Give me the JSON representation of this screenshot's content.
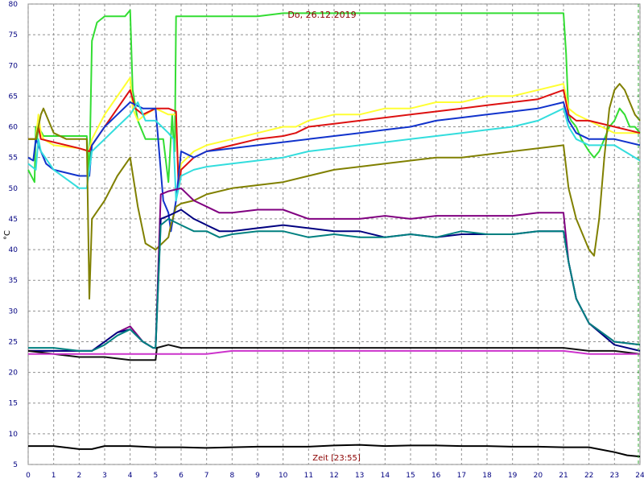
{
  "chart_data": {
    "type": "line",
    "title": "Do, 26.12.2019",
    "xlabel": "Zeit [23:55]",
    "ylabel": "°C",
    "xlim": [
      0,
      24
    ],
    "ylim": [
      5,
      80
    ],
    "x_ticks": [
      "0",
      "1",
      "2",
      "3",
      "4",
      "5",
      "6",
      "7",
      "8",
      "9",
      "10",
      "11",
      "12",
      "13",
      "14",
      "15",
      "16",
      "17",
      "18",
      "19",
      "20",
      "21",
      "22",
      "23",
      "24"
    ],
    "y_ticks": [
      "5",
      "10",
      "15",
      "20",
      "25",
      "30",
      "35",
      "40",
      "45",
      "50",
      "55",
      "60",
      "65",
      "70",
      "75",
      "80"
    ],
    "grid": true,
    "legend": "none",
    "series": [
      {
        "color": "#33dd33",
        "x": [
          0,
          0.25,
          0.3,
          0.35,
          0.4,
          0.6,
          0.8,
          1,
          2.3,
          2.4,
          2.5,
          2.7,
          3,
          3.8,
          4,
          4.1,
          4.3,
          4.6,
          5,
          5.3,
          5.5,
          5.65,
          5.7,
          5.75,
          5.8,
          6,
          7,
          8,
          9,
          10,
          12,
          14,
          16,
          18,
          20,
          21,
          21.1,
          21.2,
          21.3,
          21.5,
          21.7,
          22,
          22.2,
          22.4,
          22.6,
          22.8,
          23,
          23.2,
          23.4,
          23.6,
          23.8,
          24
        ],
        "y": [
          53,
          51,
          60,
          58,
          60,
          58.5,
          58.5,
          58.5,
          58.5,
          52,
          74,
          77,
          78,
          78,
          79,
          66,
          61,
          58,
          58,
          58,
          51,
          62,
          58,
          56,
          78,
          78,
          78,
          78,
          78,
          78.5,
          78.5,
          78.5,
          78.5,
          78.5,
          78.5,
          78.5,
          72,
          62,
          61,
          60,
          58,
          56,
          55,
          56,
          58,
          60,
          61,
          63,
          62,
          60,
          60,
          59
        ]
      },
      {
        "color": "#ffff33",
        "x": [
          0,
          0.3,
          0.4,
          0.5,
          0.6,
          0.8,
          1,
          2,
          2.4,
          2.5,
          3,
          3.5,
          4,
          4.1,
          4.3,
          4.6,
          5,
          5.5,
          5.8,
          5.9,
          6,
          6.5,
          7,
          8,
          9,
          10,
          10.5,
          11,
          12,
          13,
          14,
          15,
          16,
          17,
          18,
          19,
          20,
          21,
          21.2,
          21.5,
          22,
          23,
          23.5,
          24
        ],
        "y": [
          58,
          58,
          62,
          59,
          58,
          57.5,
          57,
          56.5,
          56,
          58,
          62,
          65,
          68,
          63,
          61,
          62,
          63,
          62,
          62,
          51,
          54,
          56,
          57,
          58,
          59,
          60,
          60,
          61,
          62,
          62,
          63,
          63,
          64,
          64,
          65,
          65,
          66,
          67,
          63,
          62,
          61,
          59,
          59,
          59
        ]
      },
      {
        "color": "#dd1111",
        "x": [
          0,
          0.3,
          0.4,
          0.5,
          1,
          2,
          2.4,
          2.5,
          3,
          3.5,
          4,
          4.2,
          4.5,
          5,
          5.5,
          5.8,
          5.9,
          6,
          6.5,
          7,
          8,
          9,
          10,
          10.5,
          11,
          12,
          13,
          14,
          15,
          16,
          17,
          18,
          19,
          20,
          21,
          21.2,
          21.5,
          22,
          23,
          24
        ],
        "y": [
          58,
          58,
          60,
          58,
          57.5,
          56.5,
          56,
          57,
          60,
          63,
          66,
          63,
          62,
          63,
          63,
          62.5,
          50,
          53,
          55,
          56,
          57,
          58,
          58.5,
          59,
          60,
          60.5,
          61,
          61.5,
          62,
          62.5,
          63,
          63.5,
          64,
          64.5,
          66,
          62,
          61,
          61,
          60,
          59
        ]
      },
      {
        "color": "#1133cc",
        "x": [
          0,
          0.2,
          0.3,
          0.5,
          0.7,
          1,
          2,
          2.4,
          2.5,
          3,
          3.5,
          4,
          4.5,
          5,
          5.3,
          5.5,
          5.6,
          5.8,
          6,
          6.5,
          7,
          8,
          9,
          10,
          11,
          12,
          13,
          14,
          15,
          16,
          17,
          18,
          19,
          20,
          21,
          21.2,
          21.5,
          22,
          23,
          24
        ],
        "y": [
          55,
          54.5,
          58,
          56,
          54,
          53,
          52,
          52,
          57,
          60,
          62,
          64,
          63,
          63,
          48,
          46,
          43,
          48,
          56,
          55,
          56,
          56.5,
          57,
          57.5,
          58,
          58.5,
          59,
          59.5,
          60,
          61,
          61.5,
          62,
          62.5,
          63,
          64,
          61,
          59,
          58,
          58,
          57
        ]
      },
      {
        "color": "#33dddd",
        "x": [
          0,
          0.3,
          0.4,
          0.5,
          1,
          2,
          2.3,
          2.5,
          3,
          3.5,
          4,
          4.3,
          4.6,
          5,
          5.5,
          5.7,
          5.8,
          6,
          6.5,
          7,
          8,
          9,
          10,
          11,
          12,
          13,
          14,
          15,
          16,
          17,
          18,
          19,
          20,
          21,
          21.2,
          21.5,
          22,
          23,
          24
        ],
        "y": [
          54,
          53,
          58,
          56,
          53,
          50,
          50,
          56,
          58,
          60,
          62,
          64,
          61,
          61,
          59,
          58,
          48,
          52,
          53,
          53.5,
          54,
          54.5,
          55,
          56,
          56.5,
          57,
          57.5,
          58,
          58.5,
          59,
          59.5,
          60,
          61,
          63,
          60,
          58,
          57,
          57,
          54.5
        ]
      },
      {
        "color": "#808000",
        "x": [
          0,
          0.3,
          0.4,
          0.5,
          0.6,
          0.8,
          1,
          1.5,
          2,
          2.3,
          2.4,
          2.5,
          3,
          3.5,
          4,
          4.3,
          4.6,
          5,
          5.5,
          5.6,
          5.8,
          6,
          6.5,
          7,
          8,
          9,
          10,
          11,
          12,
          13,
          14,
          15,
          16,
          17,
          18,
          19,
          20,
          21,
          21.2,
          21.5,
          22,
          22.2,
          22.4,
          22.6,
          22.8,
          23,
          23.2,
          23.4,
          23.6,
          23.8,
          24
        ],
        "y": [
          58,
          58,
          60,
          62,
          63,
          61,
          59,
          58,
          58,
          58,
          32,
          45,
          48,
          52,
          55,
          47,
          41,
          40,
          42,
          44,
          47,
          47.5,
          48,
          49,
          50,
          50.5,
          51,
          52,
          53,
          53.5,
          54,
          54.5,
          55,
          55,
          55.5,
          56,
          56.5,
          57,
          50,
          45,
          40,
          39,
          45,
          55,
          63,
          66,
          67,
          66,
          64,
          62,
          61
        ]
      },
      {
        "color": "#800080",
        "x": [
          0,
          1,
          2,
          2.5,
          3,
          3.5,
          4,
          4.5,
          4.9,
          5,
          5.2,
          5.5,
          6,
          6.5,
          7,
          7.5,
          8,
          9,
          10,
          11,
          12,
          13,
          14,
          15,
          16,
          17,
          18,
          19,
          20,
          21,
          21.2,
          21.5,
          22,
          23,
          24
        ],
        "y": [
          23.5,
          23.5,
          23.5,
          23.5,
          25,
          26.5,
          27.5,
          25,
          24,
          24,
          49,
          49.5,
          50,
          48,
          47,
          46,
          46,
          46.5,
          46.5,
          45,
          45,
          45,
          45.5,
          45,
          45.5,
          45.5,
          45.5,
          45.5,
          46,
          46,
          38,
          32,
          28,
          25,
          24.5
        ]
      },
      {
        "color": "#000080",
        "x": [
          0,
          1,
          2,
          2.5,
          3,
          3.5,
          4,
          4.5,
          4.9,
          5,
          5.2,
          5.5,
          6,
          6.5,
          7,
          7.5,
          8,
          9,
          10,
          11,
          12,
          13,
          14,
          15,
          16,
          17,
          18,
          19,
          20,
          21,
          21.2,
          21.5,
          22,
          23,
          24
        ],
        "y": [
          23.5,
          23.5,
          23.5,
          23.5,
          25,
          26.5,
          27,
          25,
          24,
          24,
          45,
          45.5,
          46.5,
          45,
          44,
          43,
          43,
          43.5,
          44,
          43.5,
          43,
          43,
          42,
          42.5,
          42,
          42.5,
          42.5,
          42.5,
          43,
          43,
          38,
          32,
          28,
          24.5,
          23.5
        ]
      },
      {
        "color": "#008080",
        "x": [
          0,
          1,
          2,
          2.5,
          3,
          3.5,
          4,
          4.5,
          4.9,
          5,
          5.2,
          5.5,
          6,
          6.5,
          7,
          7.5,
          8,
          9,
          10,
          11,
          12,
          13,
          14,
          15,
          16,
          17,
          18,
          19,
          20,
          21,
          21.2,
          21.5,
          22,
          23,
          24
        ],
        "y": [
          24,
          24,
          23.5,
          23.5,
          24.5,
          26,
          27,
          25,
          24,
          24,
          44,
          45,
          44,
          43,
          43,
          42,
          42.5,
          43,
          43,
          42,
          42.5,
          42,
          42,
          42.5,
          42,
          43,
          42.5,
          42.5,
          43,
          43,
          38,
          32,
          28,
          25,
          24.5
        ]
      },
      {
        "color": "#101010",
        "x": [
          0,
          1,
          2,
          3,
          4,
          5,
          5.05,
          5.5,
          6,
          8,
          10,
          12,
          14,
          16,
          18,
          20,
          21,
          22,
          23,
          24
        ],
        "y": [
          23.5,
          23,
          22.5,
          22.5,
          22,
          22,
          24,
          24.5,
          24,
          24,
          24,
          24,
          24,
          24,
          24,
          24,
          24,
          23.5,
          23.5,
          23
        ]
      },
      {
        "color": "#cc33cc",
        "x": [
          0,
          1,
          2,
          3,
          4,
          5,
          6,
          7,
          8,
          9,
          10,
          11,
          12,
          13,
          14,
          15,
          16,
          17,
          18,
          19,
          20,
          21,
          22,
          23,
          24
        ],
        "y": [
          23,
          23,
          23,
          23,
          23,
          23,
          23,
          23,
          23.5,
          23.5,
          23.5,
          23.5,
          23.5,
          23.5,
          23.5,
          23.5,
          23.5,
          23.5,
          23.5,
          23.5,
          23.5,
          23.5,
          23,
          23,
          23
        ]
      },
      {
        "color": "#000000",
        "x": [
          0,
          1,
          2,
          2.5,
          3,
          4,
          5,
          6,
          7,
          8,
          9,
          10,
          11,
          12,
          13,
          14,
          15,
          16,
          17,
          18,
          19,
          20,
          21,
          22,
          23,
          23.5,
          24
        ],
        "y": [
          8,
          8,
          7.5,
          7.5,
          8,
          8,
          7.8,
          7.8,
          7.7,
          7.8,
          7.9,
          7.9,
          7.9,
          8.1,
          8.2,
          8,
          8.1,
          8.1,
          8,
          8,
          7.9,
          7.9,
          7.8,
          7.8,
          7,
          6.5,
          6.3
        ]
      }
    ]
  }
}
